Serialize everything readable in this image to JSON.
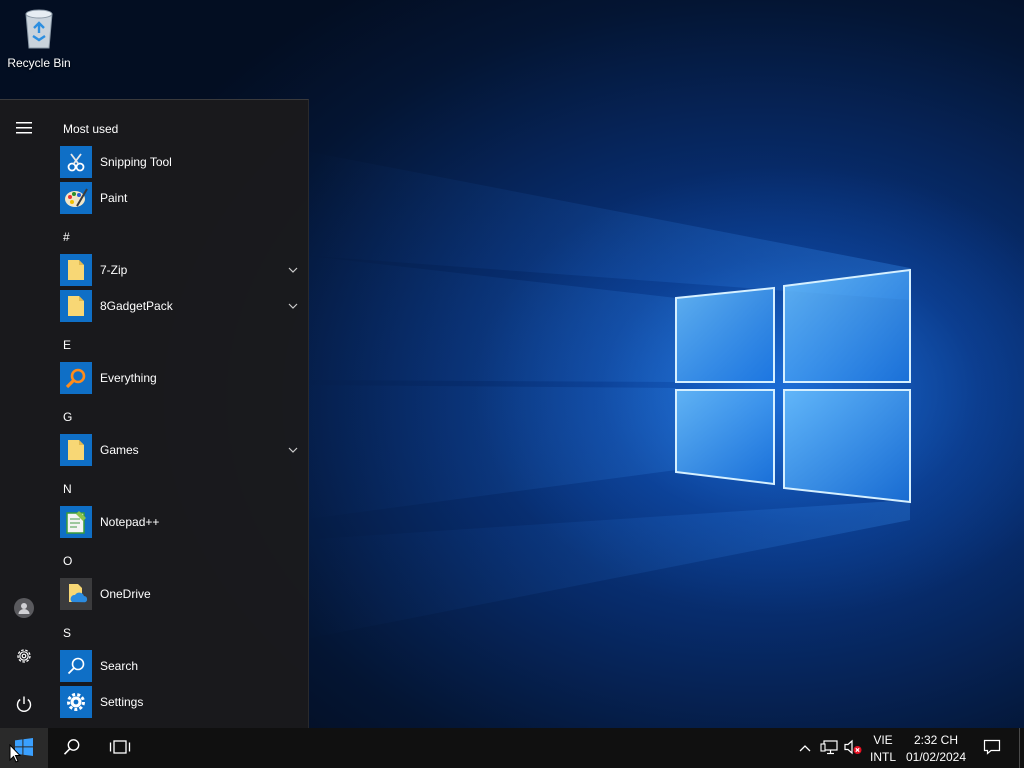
{
  "desktop": {
    "icons": [
      {
        "label": "Recycle Bin",
        "icon": "recycle-bin-icon"
      }
    ]
  },
  "start_menu": {
    "rail": {
      "menu_icon": "hamburger-menu-icon",
      "account_icon": "user-account-icon",
      "settings_icon": "gear-icon",
      "power_icon": "power-icon"
    },
    "most_used_label": "Most used",
    "most_used": [
      {
        "label": "Snipping Tool",
        "icon": "snipping-tool-icon"
      },
      {
        "label": "Paint",
        "icon": "paint-icon"
      }
    ],
    "groups": [
      {
        "letter": "#",
        "items": [
          {
            "label": "7-Zip",
            "icon": "folder-icon",
            "expandable": true
          },
          {
            "label": "8GadgetPack",
            "icon": "folder-icon",
            "expandable": true
          }
        ]
      },
      {
        "letter": "E",
        "items": [
          {
            "label": "Everything",
            "icon": "magnifier-icon",
            "expandable": false
          }
        ]
      },
      {
        "letter": "G",
        "items": [
          {
            "label": "Games",
            "icon": "folder-icon",
            "expandable": true
          }
        ]
      },
      {
        "letter": "N",
        "items": [
          {
            "label": "Notepad++",
            "icon": "notepad-plus-plus-icon",
            "expandable": false
          }
        ]
      },
      {
        "letter": "O",
        "items": [
          {
            "label": "OneDrive",
            "icon": "onedrive-icon",
            "expandable": false
          }
        ]
      },
      {
        "letter": "S",
        "items": [
          {
            "label": "Search",
            "icon": "search-icon",
            "expandable": false
          },
          {
            "label": "Settings",
            "icon": "gear-icon",
            "expandable": false
          }
        ]
      }
    ]
  },
  "taskbar": {
    "start_icon": "windows-logo-icon",
    "search_icon": "search-icon",
    "task_view_icon": "task-view-icon",
    "tray": {
      "overflow_icon": "chevron-up-icon",
      "network_icon": "network-icon",
      "volume_icon": "volume-muted-icon",
      "language_line1": "VIE",
      "language_line2": "INTL",
      "time": "2:32 CH",
      "date": "01/02/2024",
      "notification_icon": "action-center-icon"
    }
  },
  "colors": {
    "tile_blue": "#0f6fc6",
    "menu_bg": "#1a1a1c",
    "taskbar_bg": "#101010",
    "folder_yellow": "#f8d775"
  }
}
